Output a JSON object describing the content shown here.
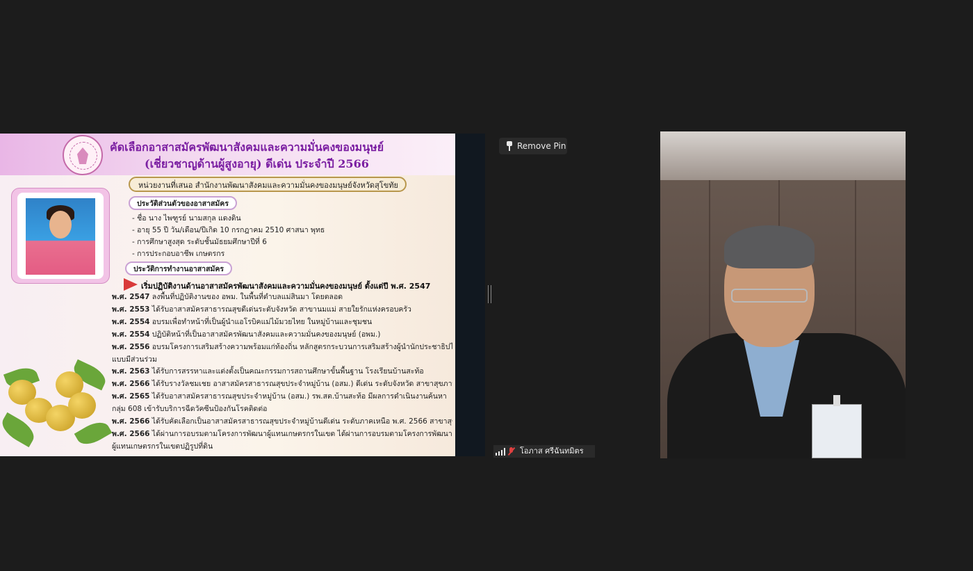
{
  "slide": {
    "title_line1": "คัดเลือกอาสาสมัครพัฒนาสังคมและความมั่นคงของมนุษย์",
    "title_line2": "(เชี่ยวชาญด้านผู้สูงอายุ) ดีเด่น ประจำปี 2566",
    "unit": "หน่วยงานที่เสนอ สำนักงานพัฒนาสังคมและความมั่นคงของมนุษย์จังหวัดสุโขทัย",
    "personal_label": "ประวัติส่วนตัวของอาสาสมัคร",
    "personal": [
      "- ชื่อ นาง ไพฑูรย์ นามสกุล แดงดิน",
      "- อายุ 55 ปี วัน/เดือน/ปีเกิด 10 กรกฎาคม 2510 ศาสนา พุทธ",
      "- การศึกษาสูงสุด ระดับชั้นมัธยมศึกษาปีที่ 6",
      "- การประกอบอาชีพ เกษตรกร"
    ],
    "work_label": "ประวัติการทำงานอาสาสมัคร",
    "start_line": "เริ่มปฏิบัติงานด้านอาสาสมัครพัฒนาสังคมและความมั่นคงของมนุษย์ ตั้งแต่ปี พ.ศ. 2547",
    "history": [
      {
        "year": "พ.ศ. 2547",
        "text": "ลงพื้นที่ปฏิบัติงานของ อพม. ในพื้นที่ตำบลแม่สินมา โดยตลอด"
      },
      {
        "year": "พ.ศ. 2553",
        "text": "ได้รับอาสาสมัครสาธารณสุขดีเด่นระดับจังหวัด สาขานมแม่ สายใยรักแห่งครอบครัว"
      },
      {
        "year": "พ.ศ. 2554",
        "text": "อบรมเพื่อทำหน้าที่เป็นผู้นำแอโรบิคแม่ไม้มวยไทย ในหมู่บ้านและชุมชน"
      },
      {
        "year": "พ.ศ. 2554",
        "text": "ปฏิบัติหน้าที่เป็นอาสาสมัครพัฒนาสังคมและความมั่นคงของมนุษย์ (อพม.)"
      },
      {
        "year": "พ.ศ. 2556",
        "text": "อบรมโครงการเสริมสร้างความพร้อมแก่ท้องถิ่น หลักสูตรกระบวนการเสริมสร้างผู้นำนักประชาธิปไตย"
      },
      {
        "year": "",
        "text": "แบบมีส่วนร่วม"
      },
      {
        "year": "พ.ศ. 2563",
        "text": "ได้รับการสรรหาและแต่งตั้งเป็นคณะกรรมการสถานศึกษาขั้นพื้นฐาน โรงเรียนบ้านสะท้อ"
      },
      {
        "year": "พ.ศ. 2566",
        "text": "ได้รับรางวัลชมเชย อาสาสมัครสาธารณสุขประจำหมู่บ้าน (อสม.) ดีเด่น ระดับจังหวัด สาขาสุขภาพจิตชุมชน"
      },
      {
        "year": "พ.ศ. 2565",
        "text": "ได้รับอาสาสมัครสาธารณสุขประจำหมู่บ้าน (อสม.) รพ.สต.บ้านสะท้อ มีผลการดำเนินงานค้นหา"
      },
      {
        "year": "",
        "text": "กลุ่ม 608 เข้ารับบริการฉีดวัคซีนป้องกันโรคติดต่อ"
      },
      {
        "year": "พ.ศ. 2566",
        "text": "ได้รับคัดเลือกเป็นอาสาสมัครสาธารณสุขประจำหมู่บ้านดีเด่น ระดับภาคเหนือ พ.ศ. 2566 สาขาสุขภาพจิตชุมชน"
      },
      {
        "year": "พ.ศ. 2566",
        "text": "ได้ผ่านการอบรมตามโครงการพัฒนาผู้แทนเกษตรกรในเขต ได้ผ่านการอบรมตามโครงการพัฒนา"
      },
      {
        "year": "",
        "text": "ผู้แทนเกษตรกรในเขตปฏิรูปที่ดิน"
      }
    ]
  },
  "pin_button": {
    "label": "Remove Pin",
    "icon": "pin-icon"
  },
  "participant": {
    "name": "โอภาส  ศรีฉันทมิตร",
    "icons": [
      "signal-icon",
      "mic-muted-icon"
    ],
    "mic_color": "#e04040"
  },
  "colors": {
    "background": "#1c1c1c",
    "title": "#7b1fa2",
    "arrow": "#d93a3a"
  }
}
